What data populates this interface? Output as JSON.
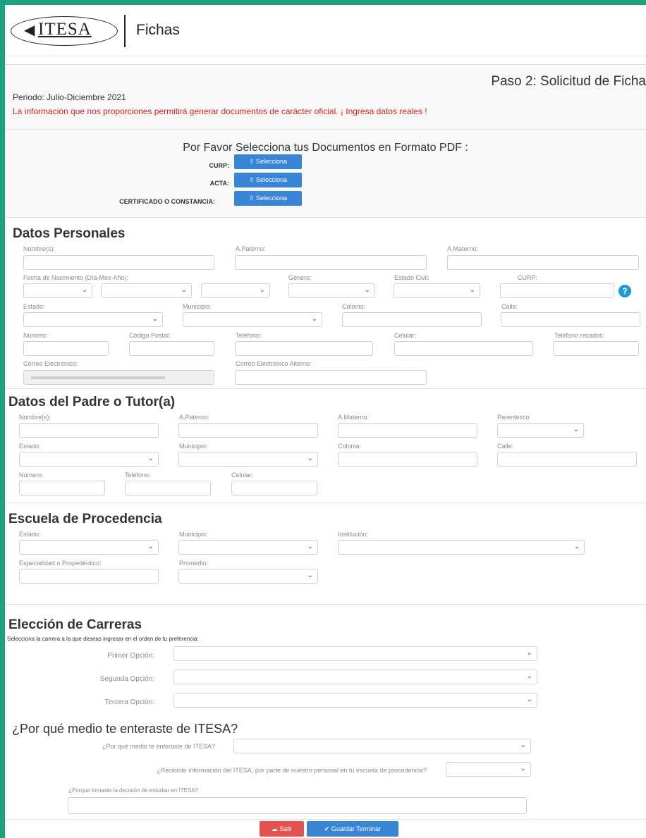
{
  "header": {
    "logo_text": "ITESA",
    "app_title": "Fichas"
  },
  "intro": {
    "step_title": "Paso 2: Solicitud de Ficha",
    "periodo": "Periodo: Julio-Diciembre 2021",
    "warning": "La información que nos proporciones permitirá generar documentos de carácter oficial. ¡ Ingresa datos reales !"
  },
  "documentos": {
    "title": "Por Favor Selecciona tus Documentos en Formato PDF :",
    "items": [
      {
        "label": "CURP:",
        "button": "Selecciona"
      },
      {
        "label": "ACTA:",
        "button": "Selecciona"
      },
      {
        "label": "CERTIFICADO O CONSTANCIA:",
        "button": "Selecciona"
      }
    ]
  },
  "datos_personales": {
    "title": "Datos Personales",
    "labels": {
      "nombre": "Nombre(s):",
      "paterno": "A.Paterno:",
      "materno": "A.Materno:",
      "fecha": "Fecha de Nacimiento (Día-Mes-Año):",
      "genero": "Género:",
      "estado_civil": "Estado Civil:",
      "curp": "CURP:",
      "estado": "Estado:",
      "municipio": "Municipio:",
      "colonia": "Colonia:",
      "calle": "Calle:",
      "numero": "Número:",
      "cp": "Código Postal:",
      "telefono": "Teléfono:",
      "celular": "Celular:",
      "tel_recados": "Teléfono recados:",
      "correo": "Correo Electrónico:",
      "correo_alt": "Correo Electrónico Alterno:"
    },
    "help_icon": "?"
  },
  "padre": {
    "title": "Datos del Padre o Tutor(a)",
    "labels": {
      "nombre": "Nombre(s):",
      "paterno": "A.Paterno:",
      "materno": "A.Materno:",
      "parentesco": "Parentesco:",
      "estado": "Estado:",
      "municipio": "Municipio:",
      "colonia": "Colonia:",
      "calle": "Calle:",
      "numero": "Número:",
      "telefono": "Teléfono:",
      "celular": "Celular:"
    }
  },
  "escuela": {
    "title": "Escuela de Procedencia",
    "labels": {
      "estado": "Estado:",
      "municipio": "Municipio:",
      "institucion": "Institución:",
      "especialidad": "Especialidad o Propedéutico:",
      "promedio": "Promedio:"
    }
  },
  "carreras": {
    "title": "Elección de Carreras",
    "subtitle": "Selecciona la carrera a la que deseas ingresar en el orden de tu preferencia:",
    "options": [
      "Primer Opción:",
      "Segunda Opción:",
      "Tercera Opción:"
    ]
  },
  "medio": {
    "title": "¿Por qué medio te enteraste de ITESA?",
    "q1": "¿Por qué medio te enteraste de ITESA?",
    "q2": "¿Recibiste información del ITESA, por parte de nuestro personal en tu escuela de procedencia?",
    "q3": "¿Porque tomaste la decisión de estudiar en ITESA?"
  },
  "footer": {
    "salir": "Salir",
    "guardar": "Guardar Terminar"
  },
  "colors": {
    "frame": "#1aa37f",
    "primary_button": "#3a86d6",
    "danger_button": "#e4524d",
    "warning_text": "#e11d1d",
    "help_icon": "#1e9bd7"
  }
}
